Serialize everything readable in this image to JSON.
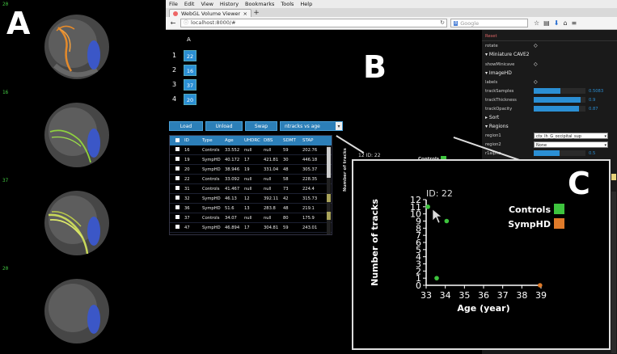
{
  "panel_labels": {
    "a": "A",
    "b": "B",
    "c": "C"
  },
  "panel_a": {
    "tick_labels": [
      "20",
      "16",
      "37",
      "20"
    ],
    "tract_colors": [
      "#e58a2a",
      "#8fd13f",
      "#c8d85a",
      null
    ],
    "region_color": "#3b57c7"
  },
  "browser": {
    "menu": [
      "File",
      "Edit",
      "View",
      "History",
      "Bookmarks",
      "Tools",
      "Help"
    ],
    "tab_title": "WebGL Volume Viewer",
    "tab_close": "×",
    "new_tab": "+",
    "url": "localhost:8000/#",
    "search_placeholder": "Google",
    "search_badge": "8"
  },
  "track_counts": {
    "header": "A",
    "rows": [
      {
        "index": "1",
        "value": "22"
      },
      {
        "index": "2",
        "value": "16"
      },
      {
        "index": "3",
        "value": "37"
      },
      {
        "index": "4",
        "value": "20"
      }
    ]
  },
  "controls": {
    "load": "Load",
    "unload": "Unload",
    "swap": "Swap",
    "plot_select": "ntracks vs age"
  },
  "table": {
    "headers": [
      "ID",
      "Type",
      "Age",
      "UHDRC",
      "DBS",
      "SDMT",
      "STAP"
    ],
    "rows": [
      [
        "16",
        "Controls",
        "33.552",
        "null",
        "null",
        "59",
        "202.76"
      ],
      [
        "19",
        "SympHD",
        "40.172",
        "17",
        "421.81",
        "30",
        "446.18"
      ],
      [
        "20",
        "SympHD",
        "38.946",
        "19",
        "331.04",
        "48",
        "305.37"
      ],
      [
        "22",
        "Controls",
        "33.092",
        "null",
        "null",
        "58",
        "228.35"
      ],
      [
        "31",
        "Controls",
        "41.467",
        "null",
        "null",
        "73",
        "224.4"
      ],
      [
        "32",
        "SympHD",
        "46.13",
        "12",
        "392.11",
        "42",
        "315.73"
      ],
      [
        "36",
        "SympHD",
        "51.6",
        "13",
        "283.8",
        "48",
        "219.1"
      ],
      [
        "37",
        "Controls",
        "34.07",
        "null",
        "null",
        "80",
        "175.9"
      ],
      [
        "47",
        "SympHD",
        "46.894",
        "17",
        "304.81",
        "59",
        "243.01"
      ]
    ]
  },
  "background_plot": {
    "ylabel": "Number of tracks",
    "id_label": "ID: 22",
    "tick": "12",
    "legend_partial": "Controls"
  },
  "settings": {
    "reset": "Reset",
    "rotate": "rotate",
    "miniature_head": "Miniature CAVE2",
    "show_minicave": "showMinicave",
    "imagehd_head": "ImageHD",
    "labels": "labels",
    "sliders": [
      {
        "label": "trackSamples",
        "value": "0.5083",
        "fraction": 0.5083
      },
      {
        "label": "trackThickness",
        "value": "0.9",
        "fraction": 0.9
      },
      {
        "label": "trackOpacity",
        "value": "0.87",
        "fraction": 0.87
      }
    ],
    "sort_head": "Sort",
    "regions_head": "Regions",
    "region1_label": "region1",
    "region1_value": "ctx_lh_G_occipital_sup",
    "region2_label": "region2",
    "region2_value": "None",
    "r1alpha_label": "r1alpha",
    "r1alpha_value": "0.5",
    "r1alpha_fraction": 0.5
  },
  "chart_data": {
    "type": "scatter",
    "title": "",
    "annotation": "ID: 22",
    "xlabel": "Age (year)",
    "ylabel": "Number of tracks",
    "xlim": [
      33,
      39
    ],
    "ylim": [
      0,
      12
    ],
    "xticks": [
      33,
      34,
      35,
      36,
      37,
      38,
      39
    ],
    "yticks": [
      0,
      1,
      2,
      3,
      4,
      5,
      6,
      7,
      8,
      9,
      10,
      11,
      12
    ],
    "series": [
      {
        "name": "Controls",
        "color": "#3ec43e",
        "points": [
          {
            "x": 33.09,
            "y": 11
          },
          {
            "x": 34.07,
            "y": 9
          },
          {
            "x": 33.55,
            "y": 1
          }
        ]
      },
      {
        "name": "SympHD",
        "color": "#e07b2a",
        "points": [
          {
            "x": 38.95,
            "y": 0
          }
        ]
      }
    ],
    "legend_placement": "top-right",
    "grid": false
  }
}
